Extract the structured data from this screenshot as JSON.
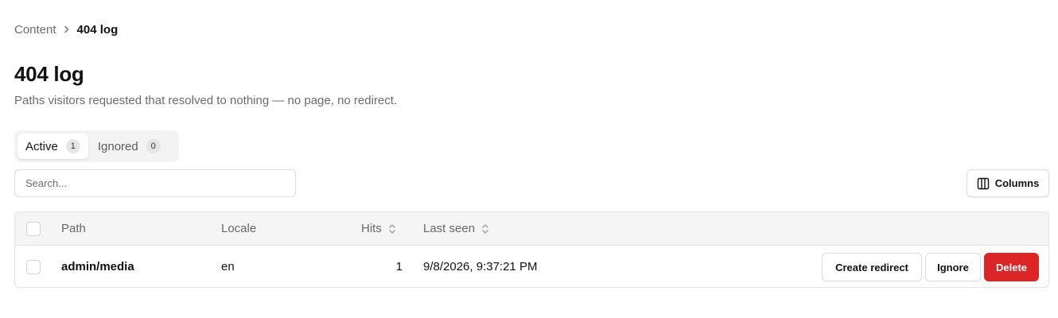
{
  "breadcrumb": {
    "parent": "Content",
    "current": "404 log",
    "separator_icon": "chevron-right-icon"
  },
  "page": {
    "title": "404 log",
    "description": "Paths visitors requested that resolved to nothing — no page, no redirect."
  },
  "tabs": [
    {
      "label": "Active",
      "count": "1",
      "selected": true
    },
    {
      "label": "Ignored",
      "count": "0",
      "selected": false
    }
  ],
  "search": {
    "placeholder": "Search...",
    "value": ""
  },
  "toolbar": {
    "columns_label": "Columns",
    "columns_icon": "columns-icon"
  },
  "table": {
    "headers": {
      "path": "Path",
      "locale": "Locale",
      "hits": "Hits",
      "last_seen": "Last seen"
    },
    "sortable_columns": [
      "Hits",
      "Last seen"
    ],
    "rows": [
      {
        "path": "admin/media",
        "locale": "en",
        "hits": "1",
        "last_seen": "9/8/2026, 9:37:21 PM",
        "actions": {
          "create_redirect": "Create redirect",
          "ignore": "Ignore",
          "delete": "Delete"
        }
      }
    ]
  },
  "colors": {
    "danger": "#dc2626",
    "muted_text": "#6b6b6b",
    "header_bg": "#f5f5f5",
    "border": "#e3e3e3"
  }
}
